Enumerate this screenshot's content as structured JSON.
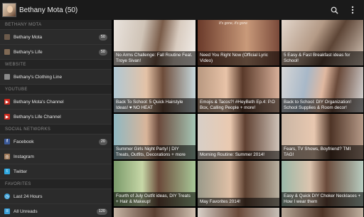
{
  "header": {
    "title": "Bethany Mota (50)",
    "search_icon": "search-icon",
    "menu_icon": "overflow-menu-icon"
  },
  "sidebar": {
    "sections": [
      {
        "label": "BETHANY MOTA",
        "items": [
          {
            "label": "Bethany Mota",
            "count": "50",
            "icon": "avatar-icon",
            "color": "#6b5a4b"
          },
          {
            "label": "Bethany's Life",
            "count": "50",
            "icon": "avatar-icon",
            "color": "#806a55"
          }
        ]
      },
      {
        "label": "WEBSITE",
        "items": [
          {
            "label": "Bethany's Clothing Line",
            "icon": "avatar-icon",
            "color": "#8a8a8a"
          }
        ]
      },
      {
        "label": "YOUTUBE",
        "items": [
          {
            "label": "Bethany Mota's Channel",
            "icon": "youtube-icon",
            "color": "#cc2a1e"
          },
          {
            "label": "Bethany's Life Channel",
            "icon": "youtube-icon",
            "color": "#cc2a1e"
          }
        ]
      },
      {
        "label": "SOCIAL NETWORKS",
        "items": [
          {
            "label": "Facebook",
            "count": "20",
            "icon": "facebook-icon",
            "color": "#3b5998"
          },
          {
            "label": "Instagram",
            "icon": "instagram-icon",
            "color": "#a07a5a"
          },
          {
            "label": "Twitter",
            "icon": "twitter-icon",
            "color": "#2fa8e0"
          }
        ]
      },
      {
        "label": "FAVORITES",
        "items": [
          {
            "label": "Last 24 Hours",
            "icon": "clock-icon",
            "color": "#3aa0d8"
          },
          {
            "label": "All Unreads",
            "count": "120",
            "icon": "list-icon",
            "color": "#3aa0d8"
          }
        ]
      }
    ]
  },
  "videos": [
    {
      "title": "No Arms Challenge: Fall Routine Feat. Troye Sivan!"
    },
    {
      "title": "Need You Right Now (Official Lyric Video)",
      "overlay": "It's gone, it's gone"
    },
    {
      "title": "5 Easy & Fast Breakfast ideas for School!"
    },
    {
      "title": "Back To School: 5 Quick Hairstyle Ideas! ♥ NO HEAT"
    },
    {
      "title": "Emojis & Tacos?! #HeyBeth Ep.4: P.O Box, Calling People + more!"
    },
    {
      "title": "Back to School: DIY Organization! School Supplies & Room decor!"
    },
    {
      "title": "Summer Girls Night Party! | DIY Treats, Outfits, Decorations + more"
    },
    {
      "title": "Morning Routine: Summer 2014!"
    },
    {
      "title": "Fears, TV Shows, Boyfriend? TMI TAG!"
    },
    {
      "title": "Fourth of July Outfit ideas, DIY Treats + Hair & Makeup!"
    },
    {
      "title": "May Favorites 2014!"
    },
    {
      "title": "Easy & Quick DIY Choker Necklaces + How I wear them"
    }
  ],
  "theme": {
    "appbar": "#1a1a1a",
    "sidebar": "#2b2b2b",
    "accent": "#3aa0d8"
  }
}
